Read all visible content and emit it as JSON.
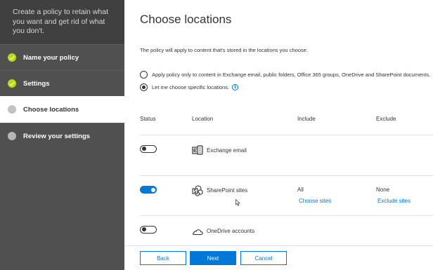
{
  "sidebar": {
    "header": "Create a policy to retain what you want and get rid of what you don't.",
    "steps": [
      {
        "label": "Name your policy",
        "state": "done"
      },
      {
        "label": "Settings",
        "state": "done"
      },
      {
        "label": "Choose locations",
        "state": "active"
      },
      {
        "label": "Review your settings",
        "state": "todo"
      }
    ]
  },
  "main": {
    "title": "Choose locations",
    "description": "The policy will apply to content that's stored in the locations you choose.",
    "radio_options": [
      {
        "label": "Apply policy only to content in Exchange email, public folders, Office 365 groups, OneDrive and SharePoint documents.",
        "checked": false
      },
      {
        "label": "Let me choose specific locations.",
        "checked": true
      }
    ],
    "table": {
      "headers": {
        "status": "Status",
        "location": "Location",
        "include": "Include",
        "exclude": "Exclude"
      },
      "rows": [
        {
          "location": "Exchange email",
          "status": "off",
          "icon": "exchange-icon"
        },
        {
          "location": "SharePoint sites",
          "status": "on",
          "icon": "sharepoint-icon",
          "include": "All",
          "include_link": "Choose sites",
          "exclude": "None",
          "exclude_link": "Exclude sites"
        },
        {
          "location": "OneDrive accounts",
          "status": "off",
          "icon": "onedrive-icon"
        }
      ]
    }
  },
  "footer": {
    "back_label": "Back",
    "next_label": "Next",
    "cancel_label": "Cancel"
  },
  "colors": {
    "accent": "#0078d7",
    "sidebar_bg": "#505050",
    "done_step": "#bad80a"
  }
}
